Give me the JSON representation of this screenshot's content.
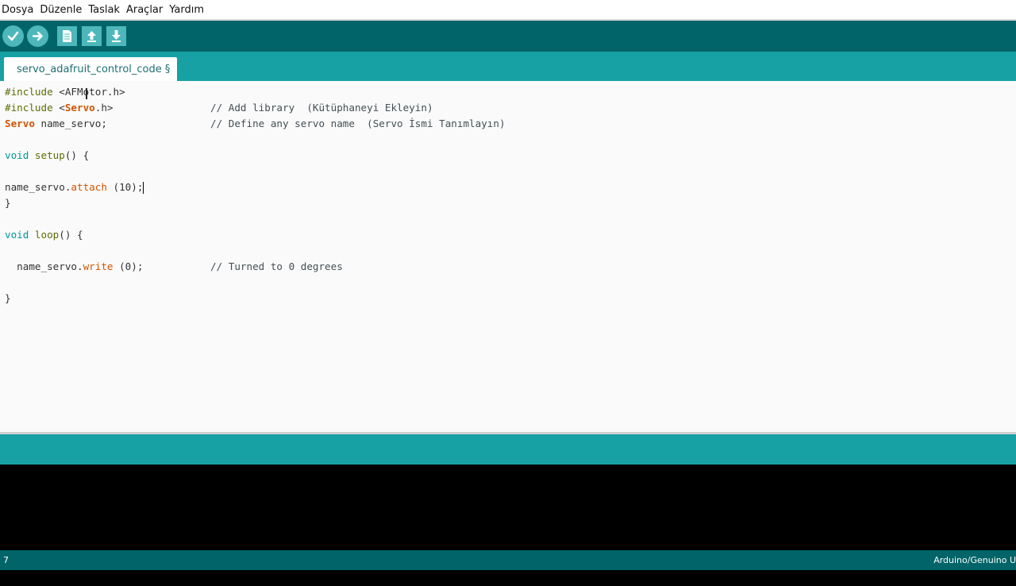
{
  "menu": [
    "Dosya",
    "Düzenle",
    "Taslak",
    "Araçlar",
    "Yardım"
  ],
  "toolbar": {
    "buttons": [
      {
        "name": "verify-button",
        "icon": "checkmark-icon"
      },
      {
        "name": "upload-button",
        "icon": "arrow-right-icon"
      },
      {
        "name": "new-button",
        "icon": "new-file-icon"
      },
      {
        "name": "open-button",
        "icon": "arrow-up-icon"
      },
      {
        "name": "save-button",
        "icon": "arrow-down-icon"
      }
    ]
  },
  "tab": {
    "label": "servo_adafruit_control_code §"
  },
  "code": {
    "l1_a": "#include",
    "l1_b": " <AFMotor.h>",
    "l2_a": "#include",
    "l2_b": " <",
    "l2_c": "Servo",
    "l2_d": ".h>",
    "l2_comment": "// Add library  (Kütüphaneyi Ekleyin)",
    "l3_a": "Servo",
    "l3_b": " name_servo;",
    "l3_comment": "// Define any servo name  (Servo İsmi Tanımlayın)",
    "l5_a": "void",
    "l5_b": " setup",
    "l5_c": "() {",
    "l7_a": "name_servo.",
    "l7_b": "attach",
    "l7_c": " (10);",
    "l8": "}",
    "l10_a": "void",
    "l10_b": " loop",
    "l10_c": "() {",
    "l12_a": "  name_servo.",
    "l12_b": "write",
    "l12_c": " (0);",
    "l12_comment": "// Turned to 0 degrees",
    "l14": "}"
  },
  "footer": {
    "line_number": "7",
    "board": "Arduino/Genuino U"
  },
  "colors": {
    "toolbar": "#006468",
    "tabbar": "#17a1a5",
    "editor": "#fafafa",
    "keyword_orange": "#d35400",
    "preproc_olive": "#5e6d03"
  }
}
